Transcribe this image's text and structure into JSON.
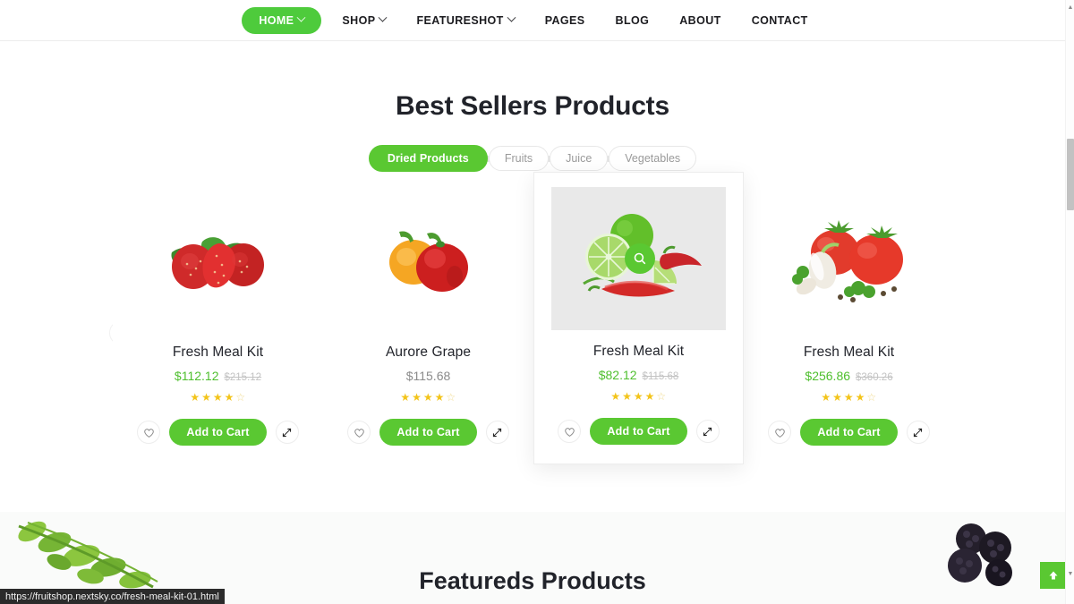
{
  "header": {
    "nav": [
      {
        "label": "HOME",
        "active": true,
        "has_dropdown": true
      },
      {
        "label": "SHOP",
        "active": false,
        "has_dropdown": true
      },
      {
        "label": "FEATURESHOT",
        "active": false,
        "has_dropdown": true
      },
      {
        "label": "PAGES",
        "active": false,
        "has_dropdown": false
      },
      {
        "label": "BLOG",
        "active": false,
        "has_dropdown": false
      },
      {
        "label": "ABOUT",
        "active": false,
        "has_dropdown": false
      },
      {
        "label": "CONTACT",
        "active": false,
        "has_dropdown": false
      }
    ]
  },
  "best_sellers": {
    "title": "Best Sellers Products",
    "filters": [
      {
        "label": "Dried Products",
        "active": true
      },
      {
        "label": "Fruits",
        "active": false
      },
      {
        "label": "Juice",
        "active": false
      },
      {
        "label": "Vegetables",
        "active": false
      }
    ],
    "prev_arrow": "←",
    "next_arrow": "→",
    "products": [
      {
        "name": "Fresh Meal Kit",
        "price": "$112.12",
        "old_price": "$215.12",
        "on_sale": true,
        "rating": 4,
        "max_rating": 5,
        "image": "strawberries",
        "add_to_cart_label": "Add to Cart",
        "wishlist_icon": "heart-icon",
        "compare_icon": "compare-icon",
        "hovered": false
      },
      {
        "name": "Aurore Grape",
        "price": "$115.68",
        "old_price": "",
        "on_sale": false,
        "rating": 4,
        "max_rating": 5,
        "image": "bell-peppers",
        "add_to_cart_label": "Add to Cart",
        "wishlist_icon": "heart-icon",
        "compare_icon": "compare-icon",
        "hovered": false
      },
      {
        "name": "Fresh Meal Kit",
        "price": "$82.12",
        "old_price": "$115.68",
        "on_sale": true,
        "rating": 4,
        "max_rating": 5,
        "image": "limes-chili",
        "add_to_cart_label": "Add to Cart",
        "wishlist_icon": "heart-icon",
        "compare_icon": "compare-icon",
        "hovered": true,
        "quickview_icon": "search-icon"
      },
      {
        "name": "Fresh Meal Kit",
        "price": "$256.86",
        "old_price": "$360.26",
        "on_sale": true,
        "rating": 4,
        "max_rating": 5,
        "image": "tomatoes-garlic",
        "add_to_cart_label": "Add to Cart",
        "wishlist_icon": "heart-icon",
        "compare_icon": "compare-icon",
        "hovered": false
      }
    ]
  },
  "featured": {
    "title": "Featureds Products"
  },
  "scroll_to_top": {
    "icon": "arrow-up-icon"
  },
  "status_bar": {
    "url": "https://fruitshop.nextsky.co/fresh-meal-kit-01.html"
  },
  "colors": {
    "brand_green": "#5ac832",
    "nav_pill_green": "#4ecb3c",
    "price_green": "#4fbf2e",
    "star_gold": "#f3c41a",
    "old_price_gray": "#c3c3c3",
    "text_dark": "#21232a",
    "muted": "#9a9a9a",
    "section_bg": "#fafbfa",
    "thumb_bg_hover": "#e9e9e9"
  }
}
